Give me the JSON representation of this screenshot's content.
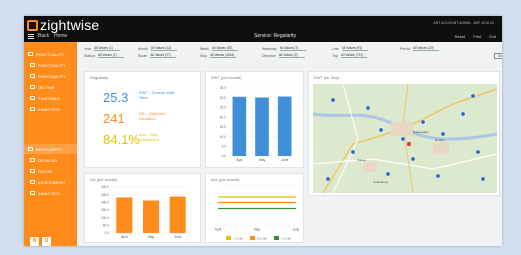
{
  "app": {
    "logo": "zightwise",
    "center_title": "Service: Regularity",
    "user_line": "ANT ACCOUNT ADMIN - 8GF 2016 01",
    "nav": [
      "Back",
      "Home"
    ],
    "right_links": [
      "Reset",
      "Print",
      "Exit"
    ]
  },
  "sidebar": {
    "items": [
      {
        "label": "PUNCTUALITY",
        "icon": "clock-icon"
      },
      {
        "label": "PUNCTUALITY",
        "icon": "route-icon"
      },
      {
        "label": "PUNCTUALITY",
        "icon": "stop-icon"
      },
      {
        "label": "ON TIME",
        "icon": "time-icon"
      },
      {
        "label": "TIMETABLE",
        "icon": "table-icon"
      },
      {
        "label": "ANALYTICS",
        "icon": "chart-icon"
      },
      {
        "label": "REGULARITY",
        "icon": "pulse-icon"
      },
      {
        "label": "DETAILED",
        "icon": "list-icon"
      },
      {
        "label": "ROUTE",
        "icon": "route-icon"
      },
      {
        "label": "ASSESSMENT",
        "icon": "check-icon"
      },
      {
        "label": "ANALYTICS",
        "icon": "chart-icon"
      }
    ],
    "buttons": [
      "6",
      "0"
    ]
  },
  "filters": [
    {
      "label": "Year",
      "value": "All Values (1)"
    },
    {
      "label": "Month",
      "value": "All Values (12)"
    },
    {
      "label": "Week",
      "value": "All Values (53)"
    },
    {
      "label": "Weekday",
      "value": "All Values (7)"
    },
    {
      "label": "Line",
      "value": "All Values (91)"
    },
    {
      "label": "Period",
      "value": "All Values (20)"
    },
    {
      "label": "Station",
      "value": "All Values (1)"
    },
    {
      "label": "Route",
      "value": "All Values (27)"
    },
    {
      "label": "Stop",
      "value": "All Values (4004)"
    },
    {
      "label": "Direction",
      "value": "All Values (2)"
    },
    {
      "label": "Trip",
      "value": "All Values (737)"
    }
  ],
  "go_label": "Go",
  "kpi": {
    "title": "Regularity",
    "rows": [
      {
        "value": "25.3",
        "desc": "EWT – Excess Wait Time",
        "color": "#3e8fd8"
      },
      {
        "value": "241",
        "desc": "SD – Standard Deviation",
        "color": "#ff8c1a"
      },
      {
        "value": "84.1%",
        "desc": "Acc – Stop Adjustment",
        "color": "#e2c200"
      }
    ]
  },
  "chart_blue": {
    "title": "EWT (per month)",
    "chart_data": {
      "type": "bar",
      "categories": [
        "Aprl",
        "May",
        "June"
      ],
      "values": [
        30.5,
        30.1,
        30.6
      ],
      "ylim": [
        0,
        35
      ],
      "yticks": [
        "35.0",
        "30.0",
        "25.0",
        "20.0",
        "15.0",
        "10.0",
        "5.0",
        "0.0"
      ],
      "color": "#3e8fd8"
    }
  },
  "chart_orange": {
    "title": "SD (per month)",
    "chart_data": {
      "type": "bar",
      "categories": [
        "April",
        "May",
        "June"
      ],
      "values": [
        232.0,
        212.0,
        238.0
      ],
      "ylim": [
        0,
        300
      ],
      "yticks": [
        "300.0",
        "250.0",
        "200.0",
        "150.0",
        "100.0",
        "50.0",
        "0.0"
      ],
      "color": "#ff8c1a"
    }
  },
  "chart_lines": {
    "title": "Acc (per month)",
    "legend": [
      "< 2 min",
      "2-5 min",
      "> 5 min"
    ],
    "colors": [
      "#e2c200",
      "#ff8c1a",
      "#3f8a3a"
    ],
    "chart_data": {
      "type": "line",
      "x": [
        "April",
        "May",
        "June"
      ],
      "series": [
        {
          "name": "< 2 min",
          "values": [
            58,
            58,
            58
          ]
        },
        {
          "name": "2-5 min",
          "values": [
            47,
            47,
            47
          ]
        },
        {
          "name": "> 5 min",
          "values": [
            35,
            35,
            35
          ]
        }
      ],
      "ylim": [
        0,
        80
      ]
    }
  },
  "map": {
    "title": "EWT per Stop",
    "places": [
      "Nieuwegein",
      "Houten",
      "Vianen",
      "Culemborg"
    ]
  }
}
